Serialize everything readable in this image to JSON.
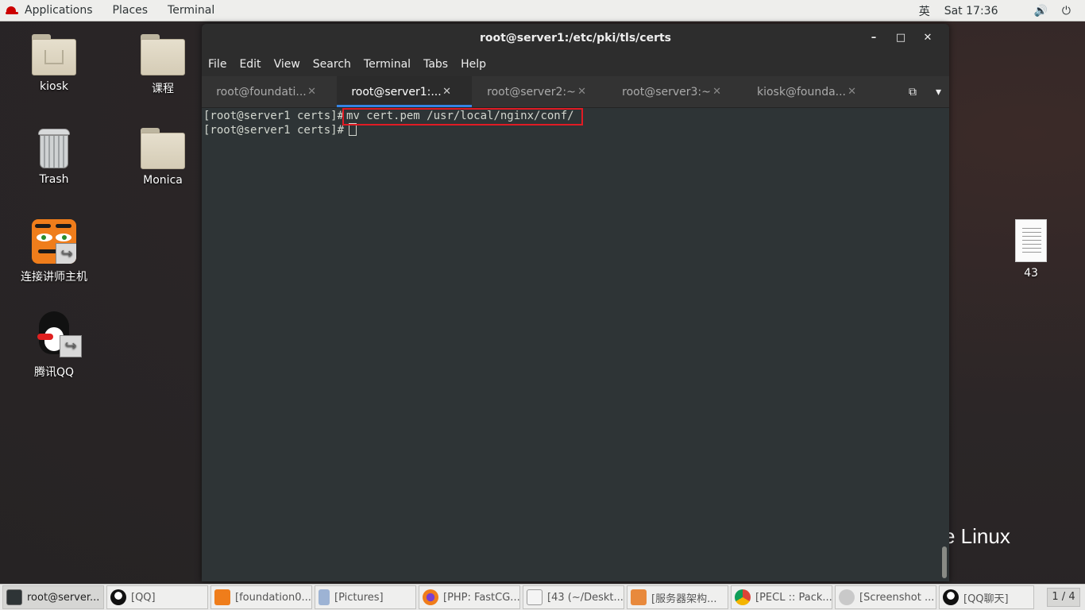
{
  "topbar": {
    "applications": "Applications",
    "places": "Places",
    "terminal": "Terminal",
    "input_method": "英",
    "clock": "Sat 17:36",
    "volume_icon": "🔊",
    "power_icon": "⏻"
  },
  "desktop_icons": {
    "kiosk": "kiosk",
    "course": "课程",
    "trash": "Trash",
    "monica": "Monica",
    "connect": "连接讲师主机",
    "qq": "腾讯QQ",
    "file43": "43"
  },
  "window": {
    "title": "root@server1:/etc/pki/tls/certs",
    "minimize": "–",
    "maximize": "□",
    "close": "✕",
    "menu": [
      "File",
      "Edit",
      "View",
      "Search",
      "Terminal",
      "Tabs",
      "Help"
    ],
    "tabs": [
      {
        "label": "root@foundati..."
      },
      {
        "label": "root@server1:..."
      },
      {
        "label": "root@server2:~"
      },
      {
        "label": "root@server3:~"
      },
      {
        "label": "kiosk@founda..."
      }
    ],
    "tab_close": "✕",
    "new_tab_icon": "⧉",
    "tab_menu_icon": "▾"
  },
  "terminal": {
    "line1_prompt": "[root@server1 certs]#",
    "line1_command": "mv cert.pem /usr/local/nginx/conf/",
    "line2_prompt": "[root@server1 certs]#"
  },
  "brand_text": "e Linux",
  "taskbar": {
    "items": [
      "root@server...",
      "[QQ]",
      "[foundation0....",
      "[Pictures]",
      "[PHP: FastCG...",
      "[43 (~/Deskt...",
      "[服务器架构...",
      "[PECL :: Pack...",
      "[Screenshot ...",
      "[QQ聊天]"
    ],
    "pager": "1 / 4"
  }
}
